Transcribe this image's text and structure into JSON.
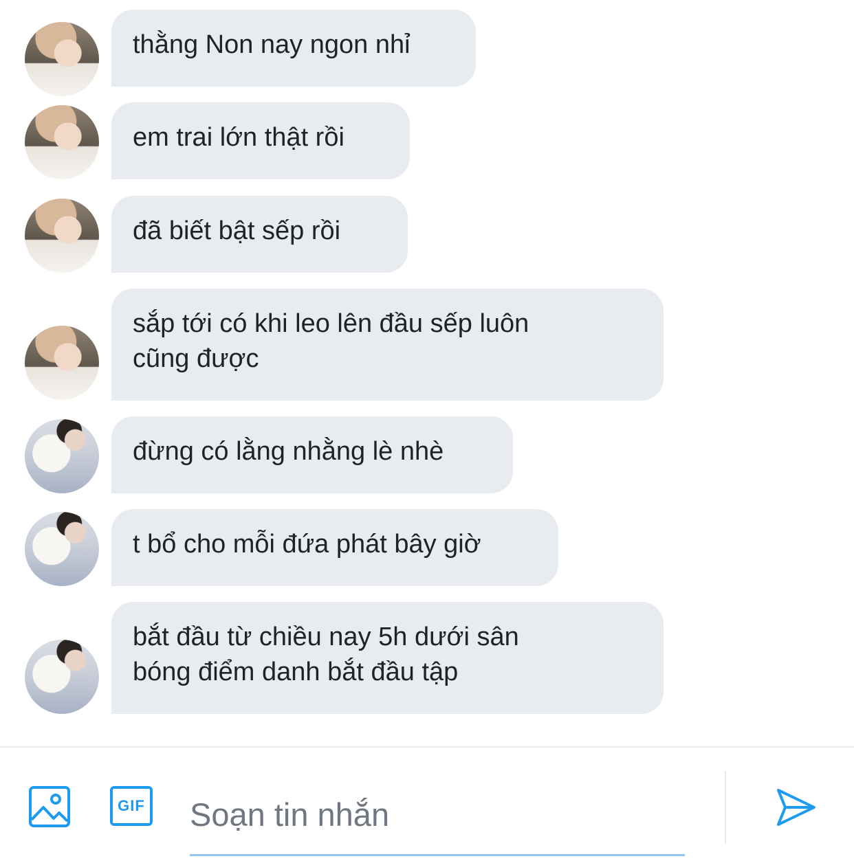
{
  "messages": [
    {
      "text": "thằng Non nay ngon nhỉ",
      "avatar": "avatar-a"
    },
    {
      "text": "em trai lớn thật rồi",
      "avatar": "avatar-a"
    },
    {
      "text": "đã biết bật sếp rồi",
      "avatar": "avatar-a"
    },
    {
      "text": "sắp tới có khi leo lên đầu sếp luôn\ncũng được",
      "avatar": "avatar-a"
    },
    {
      "text": "đừng có lằng nhằng lè nhè",
      "avatar": "avatar-b"
    },
    {
      "text": "t bổ cho mỗi đứa phát bây giờ",
      "avatar": "avatar-b"
    },
    {
      "text": "bắt đầu từ chiều nay 5h dưới sân\nbóng điểm danh bắt đầu tập",
      "avatar": "avatar-b"
    }
  ],
  "composer": {
    "placeholder": "Soạn tin nhắn",
    "gif_label": "GIF",
    "icons": [
      "image-icon",
      "gif-icon",
      "send-icon"
    ]
  },
  "colors": {
    "accent": "#1d9bf0",
    "bubble_bg": "#e8ebef",
    "text": "#1f2328",
    "placeholder": "#6f7780"
  }
}
